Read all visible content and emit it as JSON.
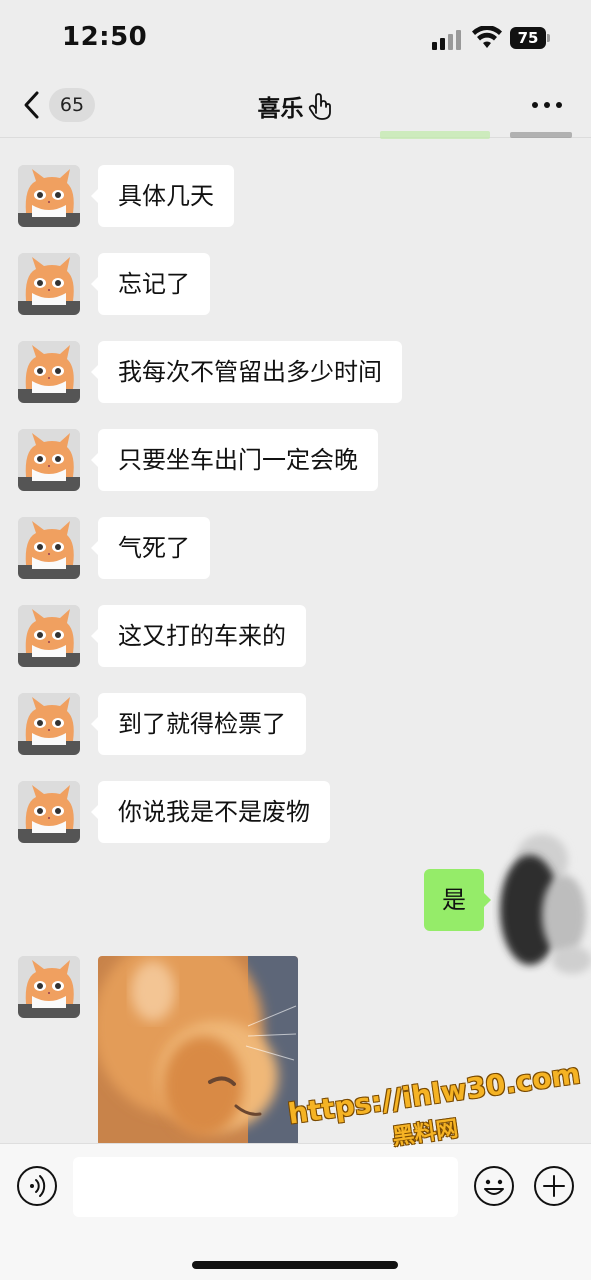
{
  "status_bar": {
    "time": "12:50",
    "battery": "75"
  },
  "nav": {
    "unread_count": "65",
    "title": "喜乐",
    "title_emoji": "hand-icon"
  },
  "messages": [
    {
      "from": "contact",
      "text": "具体几天"
    },
    {
      "from": "contact",
      "text": "忘记了"
    },
    {
      "from": "contact",
      "text": "我每次不管留出多少时间"
    },
    {
      "from": "contact",
      "text": "只要坐车出门一定会晚"
    },
    {
      "from": "contact",
      "text": "气死了"
    },
    {
      "from": "contact",
      "text": "这又打的车来的"
    },
    {
      "from": "contact",
      "text": "到了就得检票了"
    },
    {
      "from": "contact",
      "text": "你说我是不是废物"
    },
    {
      "from": "me",
      "text": "是"
    },
    {
      "from": "contact",
      "type": "image",
      "image": "orange-cat-photo"
    }
  ],
  "input_bar": {
    "placeholder": ""
  },
  "watermark": {
    "url": "https://ihlw30.com",
    "name": "黑料网"
  },
  "colors": {
    "background": "#ededed",
    "my_bubble": "#95ec69",
    "their_bubble": "#ffffff",
    "input_bar": "#f7f7f7"
  }
}
